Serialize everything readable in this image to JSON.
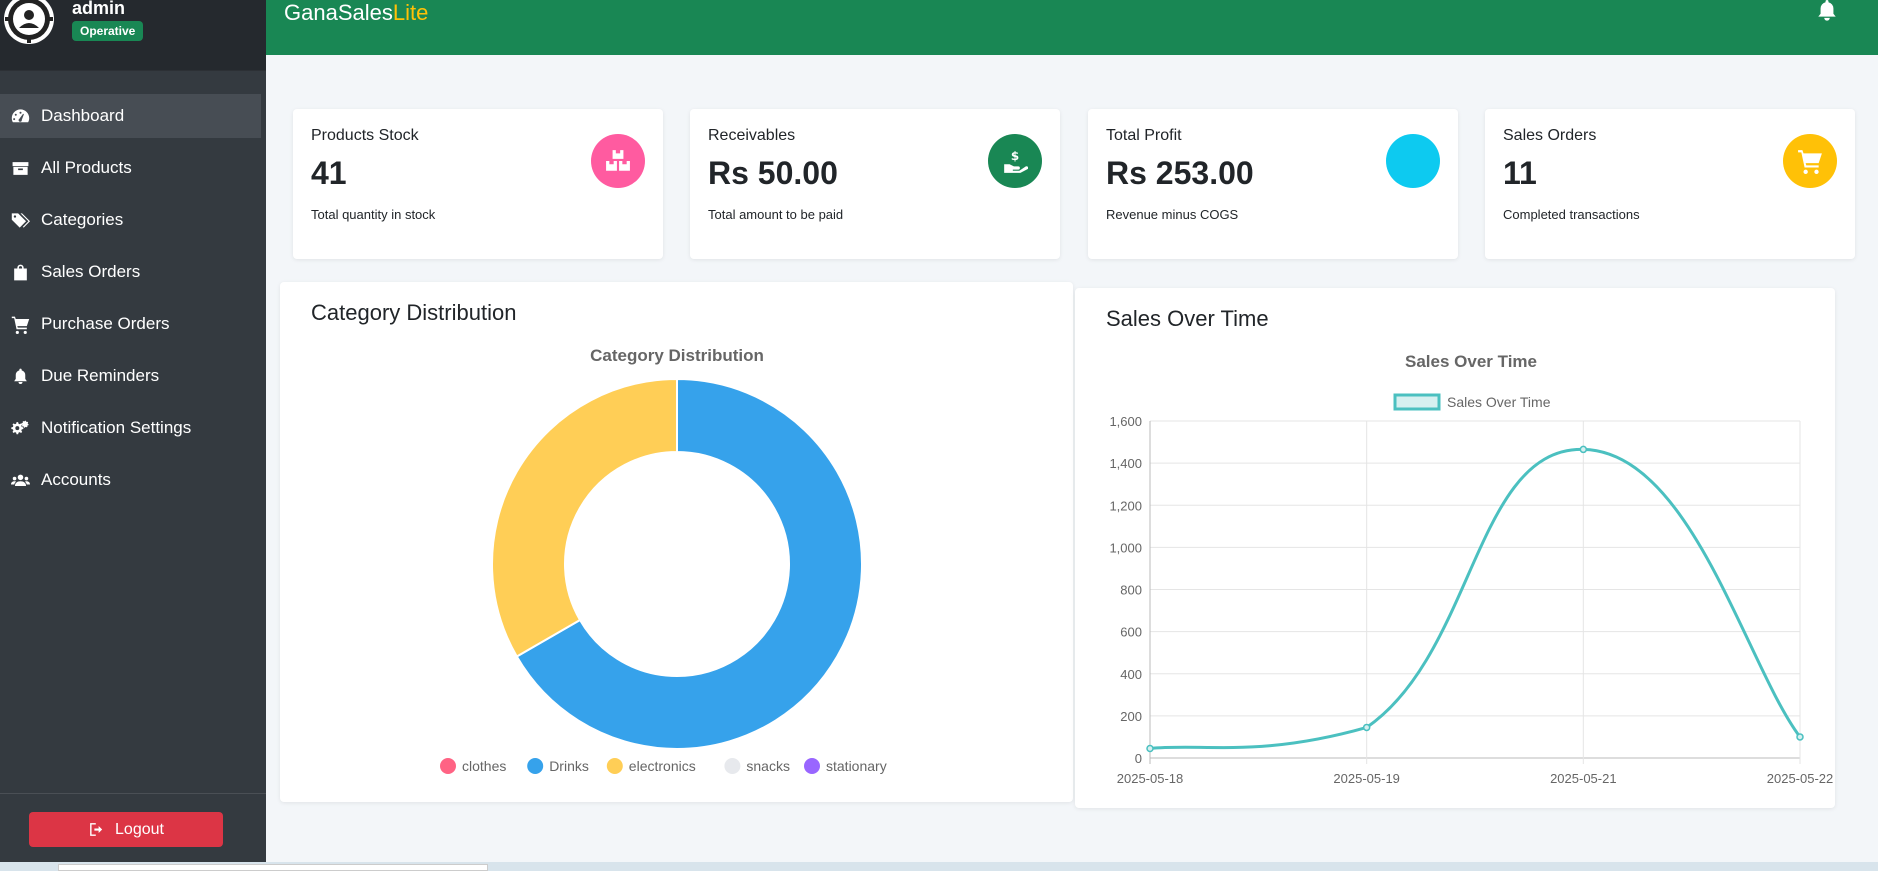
{
  "sidebar": {
    "user": "admin",
    "status": "Operative",
    "items": [
      {
        "label": "Dashboard",
        "icon": "gauge-icon",
        "active": true
      },
      {
        "label": "All Products",
        "icon": "box-icon"
      },
      {
        "label": "Categories",
        "icon": "tags-icon"
      },
      {
        "label": "Sales Orders",
        "icon": "shopping-bag-icon"
      },
      {
        "label": "Purchase Orders",
        "icon": "cart-icon"
      },
      {
        "label": "Due Reminders",
        "icon": "bell-icon"
      },
      {
        "label": "Notification Settings",
        "icon": "gears-icon"
      },
      {
        "label": "Accounts",
        "icon": "users-icon"
      }
    ],
    "logout_label": "Logout"
  },
  "header": {
    "brand_main": "GanaSales",
    "brand_accent": "Lite",
    "icon": "bell-icon"
  },
  "cards": [
    {
      "title": "Products Stock",
      "value": "41",
      "sub": "Total quantity in stock",
      "color": "#ff5ba0",
      "icon": "boxes-icon"
    },
    {
      "title": "Receivables",
      "value": "Rs 50.00",
      "sub": "Total amount to be paid",
      "color": "#198754",
      "icon": "hand-dollar-icon"
    },
    {
      "title": "Total Profit",
      "value": "Rs 253.00",
      "sub": "Revenue minus COGS",
      "color": "#0dcaf0",
      "icon": "none"
    },
    {
      "title": "Sales Orders",
      "value": "11",
      "sub": "Completed transactions",
      "color": "#ffc107",
      "icon": "cart-icon"
    }
  ],
  "panels": {
    "category_title": "Category Distribution",
    "sales_title": "Sales Over Time"
  },
  "chart_data": [
    {
      "type": "pie",
      "title": "Category Distribution",
      "categories": [
        "clothes",
        "Drinks",
        "electronics",
        "snacks",
        "stationary"
      ],
      "values": [
        0,
        2,
        1,
        0,
        0
      ],
      "colors": [
        "#ff6384",
        "#36a2eb",
        "#ffce56",
        "#e7e9ed",
        "#9966ff"
      ],
      "legend": "bottom"
    },
    {
      "type": "line",
      "title": "Sales Over Time",
      "x": [
        "2025-05-18",
        "2025-05-19",
        "2025-05-21",
        "2025-05-22"
      ],
      "series": [
        {
          "name": "Sales Over Time",
          "values": [
            45,
            145,
            1465,
            100
          ],
          "color": "#4bc0c0"
        }
      ],
      "ylim": [
        0,
        1600
      ],
      "yticks": [
        0,
        200,
        400,
        600,
        800,
        1000,
        1200,
        1400,
        1600
      ],
      "ytick_labels": [
        "0",
        "200",
        "400",
        "600",
        "800",
        "1,000",
        "1,200",
        "1,400",
        "1,600"
      ],
      "grid": true,
      "legend": "top"
    }
  ]
}
